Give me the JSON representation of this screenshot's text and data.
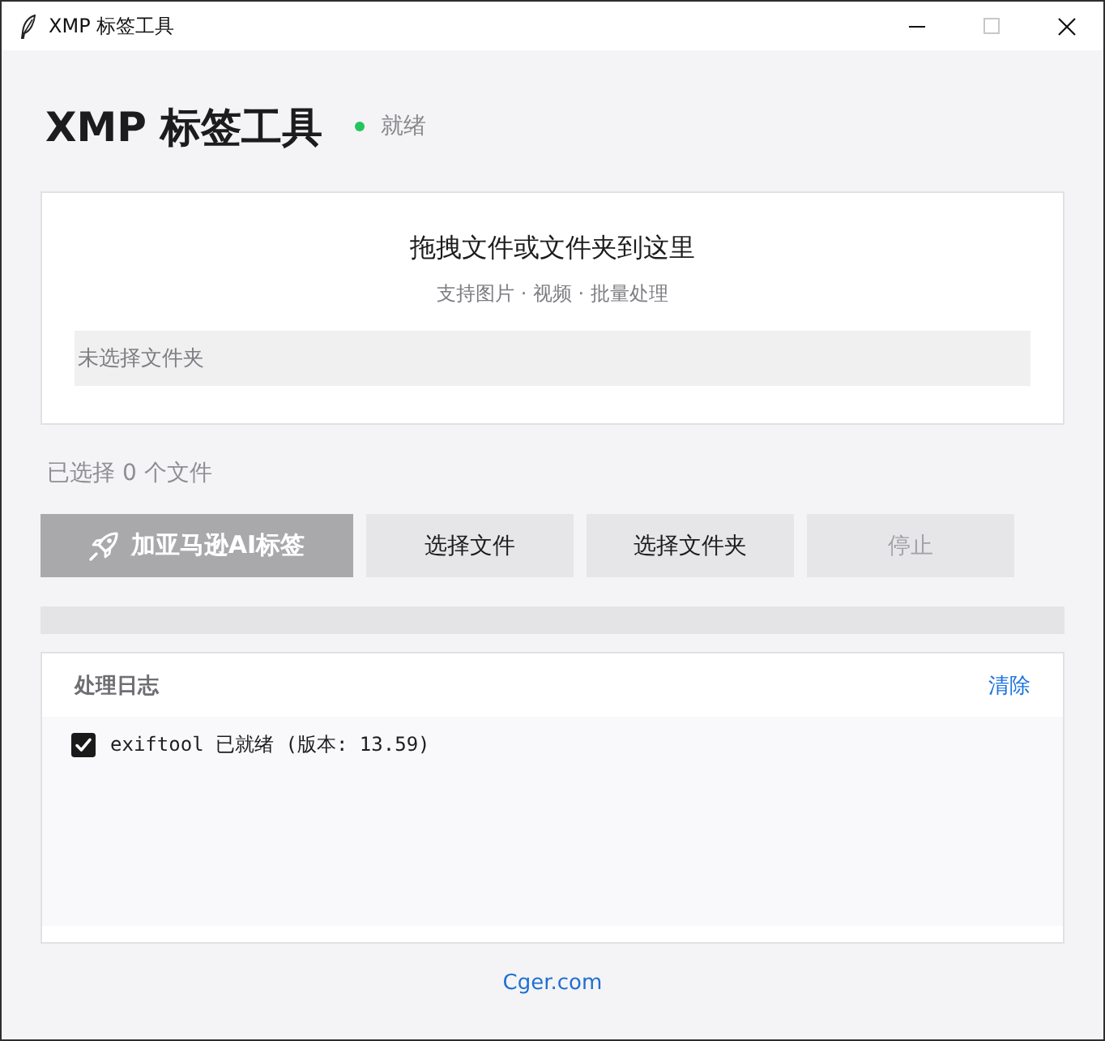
{
  "window": {
    "title": "XMP 标签工具"
  },
  "header": {
    "title": "XMP 标签工具",
    "status": {
      "kind": "ready",
      "text": "就绪"
    }
  },
  "drop_zone": {
    "title": "拖拽文件或文件夹到这里",
    "subtitle": "支持图片 · 视频 · 批量处理",
    "path_field": {
      "placeholder": "未选择文件夹"
    }
  },
  "selection_count": "已选择 0 个文件",
  "buttons": [
    {
      "kind": "primary",
      "label": "加亚马逊AI标签",
      "disabled": true
    },
    {
      "kind": "secondary",
      "label": "选择文件",
      "disabled": false
    },
    {
      "kind": "secondary",
      "label": "选择文件夹",
      "disabled": false
    },
    {
      "kind": "secondary",
      "label": "停止",
      "disabled": true
    }
  ],
  "log": {
    "title": "处理日志",
    "clear_link": "清除",
    "entries": [
      {
        "kind": "success",
        "text": "exiftool 已就绪 (版本: 13.59)"
      }
    ]
  },
  "footer": {
    "link": "Cger.com"
  }
}
